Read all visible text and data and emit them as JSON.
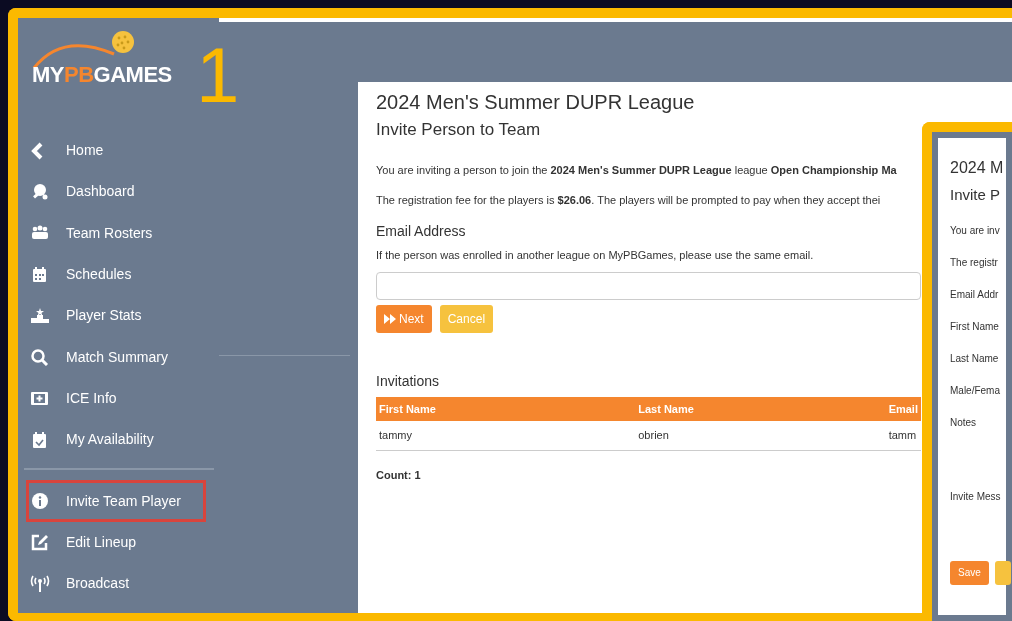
{
  "annotation": {
    "step": "1"
  },
  "logo": {
    "parts": [
      {
        "text": "MY",
        "accent": false
      },
      {
        "text": "PB",
        "accent": true
      },
      {
        "text": "GAMES",
        "accent": false
      }
    ]
  },
  "sidebar": {
    "groups": [
      [
        {
          "label": "Home",
          "highlighted": false
        },
        {
          "label": "Dashboard",
          "highlighted": false
        },
        {
          "label": "Team Rosters",
          "highlighted": false
        },
        {
          "label": "Schedules",
          "highlighted": false
        },
        {
          "label": "Player Stats",
          "highlighted": false
        },
        {
          "label": "Match Summary",
          "highlighted": false
        },
        {
          "label": "ICE Info",
          "highlighted": false
        },
        {
          "label": "My Availability",
          "highlighted": false
        }
      ],
      [
        {
          "label": "Invite Team Player",
          "highlighted": true
        },
        {
          "label": "Edit Lineup",
          "highlighted": false
        },
        {
          "label": "Broadcast",
          "highlighted": false
        }
      ]
    ]
  },
  "main": {
    "title": "2024 Men's Summer DUPR League",
    "subtitle": "Invite Person to Team",
    "paragraphs": [
      "You are inviting a person to join the **2024 Men's Summer DUPR League** league **Open Championship Ma**",
      "The registration fee for the players is **$26.06**. The players will be prompted to pay when they accept thei"
    ],
    "email_label": "Email Address",
    "email_hint": "If the person was enrolled in another league on MyPBGames, please use the same email.",
    "buttons": [
      {
        "label": "Next",
        "kind": "primary"
      },
      {
        "label": "Cancel",
        "kind": "warning"
      }
    ],
    "invitations": {
      "title": "Invitations",
      "columns": [
        "First Name",
        "Last Name",
        "Email"
      ],
      "rows": [
        [
          "tammy",
          "obrien",
          "tamm"
        ]
      ],
      "count": "Count: 1"
    }
  },
  "second_window": {
    "title": "2024 M",
    "subtitle": "Invite P",
    "lines": [
      "You are inv",
      "The registr"
    ],
    "fields": [
      "Email Addr",
      "First Name",
      "Last Name",
      "Male/Fema",
      "Notes",
      "Invite Mess"
    ],
    "buttons": [
      {
        "label": "Save",
        "kind": "primary"
      },
      {
        "kind": "warning"
      }
    ]
  }
}
